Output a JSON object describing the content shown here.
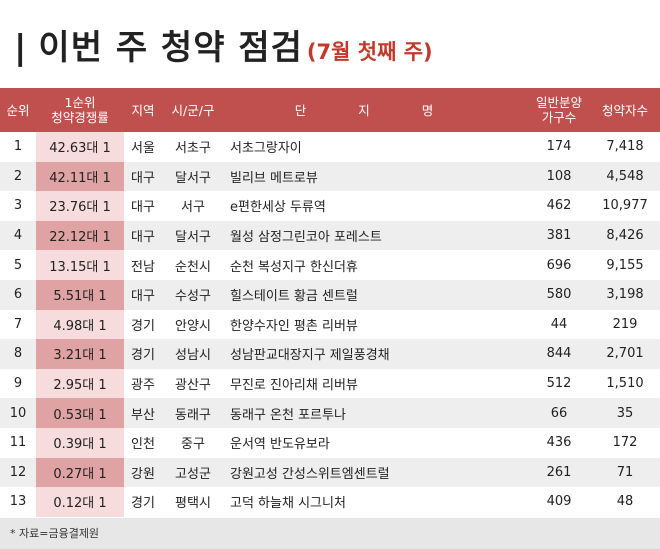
{
  "title": {
    "bar": "|",
    "main": "이번 주 청약 점검",
    "sub": "(7월 첫째 주)"
  },
  "table": {
    "headers": {
      "rank": "순위",
      "rate_line1": "1순위",
      "rate_line2": "청약경쟁률",
      "region": "지역",
      "city": "시/군/구",
      "name": "단 지 명",
      "units_line1": "일반분양",
      "units_line2": "가구수",
      "apps": "청약자수"
    },
    "rows": [
      {
        "rank": "1",
        "rate": "42.63대 1",
        "region": "서울",
        "city": "서초구",
        "name": "서초그랑자이",
        "units": "174",
        "apps": "7,418"
      },
      {
        "rank": "2",
        "rate": "42.11대 1",
        "region": "대구",
        "city": "달서구",
        "name": "빌리브 메트로뷰",
        "units": "108",
        "apps": "4,548"
      },
      {
        "rank": "3",
        "rate": "23.76대 1",
        "region": "대구",
        "city": "서구",
        "name": "e편한세상 두류역",
        "units": "462",
        "apps": "10,977"
      },
      {
        "rank": "4",
        "rate": "22.12대 1",
        "region": "대구",
        "city": "달서구",
        "name": "월성 삼정그린코아 포레스트",
        "units": "381",
        "apps": "8,426"
      },
      {
        "rank": "5",
        "rate": "13.15대 1",
        "region": "전남",
        "city": "순천시",
        "name": "순천 복성지구 한신더휴",
        "units": "696",
        "apps": "9,155"
      },
      {
        "rank": "6",
        "rate": "5.51대 1",
        "region": "대구",
        "city": "수성구",
        "name": "힐스테이트 황금 센트럴",
        "units": "580",
        "apps": "3,198"
      },
      {
        "rank": "7",
        "rate": "4.98대 1",
        "region": "경기",
        "city": "안양시",
        "name": "한양수자인 평촌 리버뷰",
        "units": "44",
        "apps": "219"
      },
      {
        "rank": "8",
        "rate": "3.21대 1",
        "region": "경기",
        "city": "성남시",
        "name": "성남판교대장지구 제일풍경채",
        "units": "844",
        "apps": "2,701"
      },
      {
        "rank": "9",
        "rate": "2.95대 1",
        "region": "광주",
        "city": "광산구",
        "name": "무진로 진아리채 리버뷰",
        "units": "512",
        "apps": "1,510"
      },
      {
        "rank": "10",
        "rate": "0.53대 1",
        "region": "부산",
        "city": "동래구",
        "name": "동래구 온천 포르투나",
        "units": "66",
        "apps": "35"
      },
      {
        "rank": "11",
        "rate": "0.39대 1",
        "region": "인천",
        "city": "중구",
        "name": "운서역 반도유보라",
        "units": "436",
        "apps": "172"
      },
      {
        "rank": "12",
        "rate": "0.27대 1",
        "region": "강원",
        "city": "고성군",
        "name": "강원고성 간성스위트엠센트럴",
        "units": "261",
        "apps": "71"
      },
      {
        "rank": "13",
        "rate": "0.12대 1",
        "region": "경기",
        "city": "평택시",
        "name": "고덕 하늘채 시그니처",
        "units": "409",
        "apps": "48"
      }
    ]
  },
  "footer": {
    "note": "* 자료=금융결제원"
  },
  "colors": {
    "header_bg": "#c0504d",
    "title_sub": "#c0392b",
    "rate_cell_dark": "#dfa3a3",
    "rate_cell_light": "#f6dcdc",
    "row_alt": "#eeeeee",
    "footer_bg": "#e7e7e7"
  }
}
